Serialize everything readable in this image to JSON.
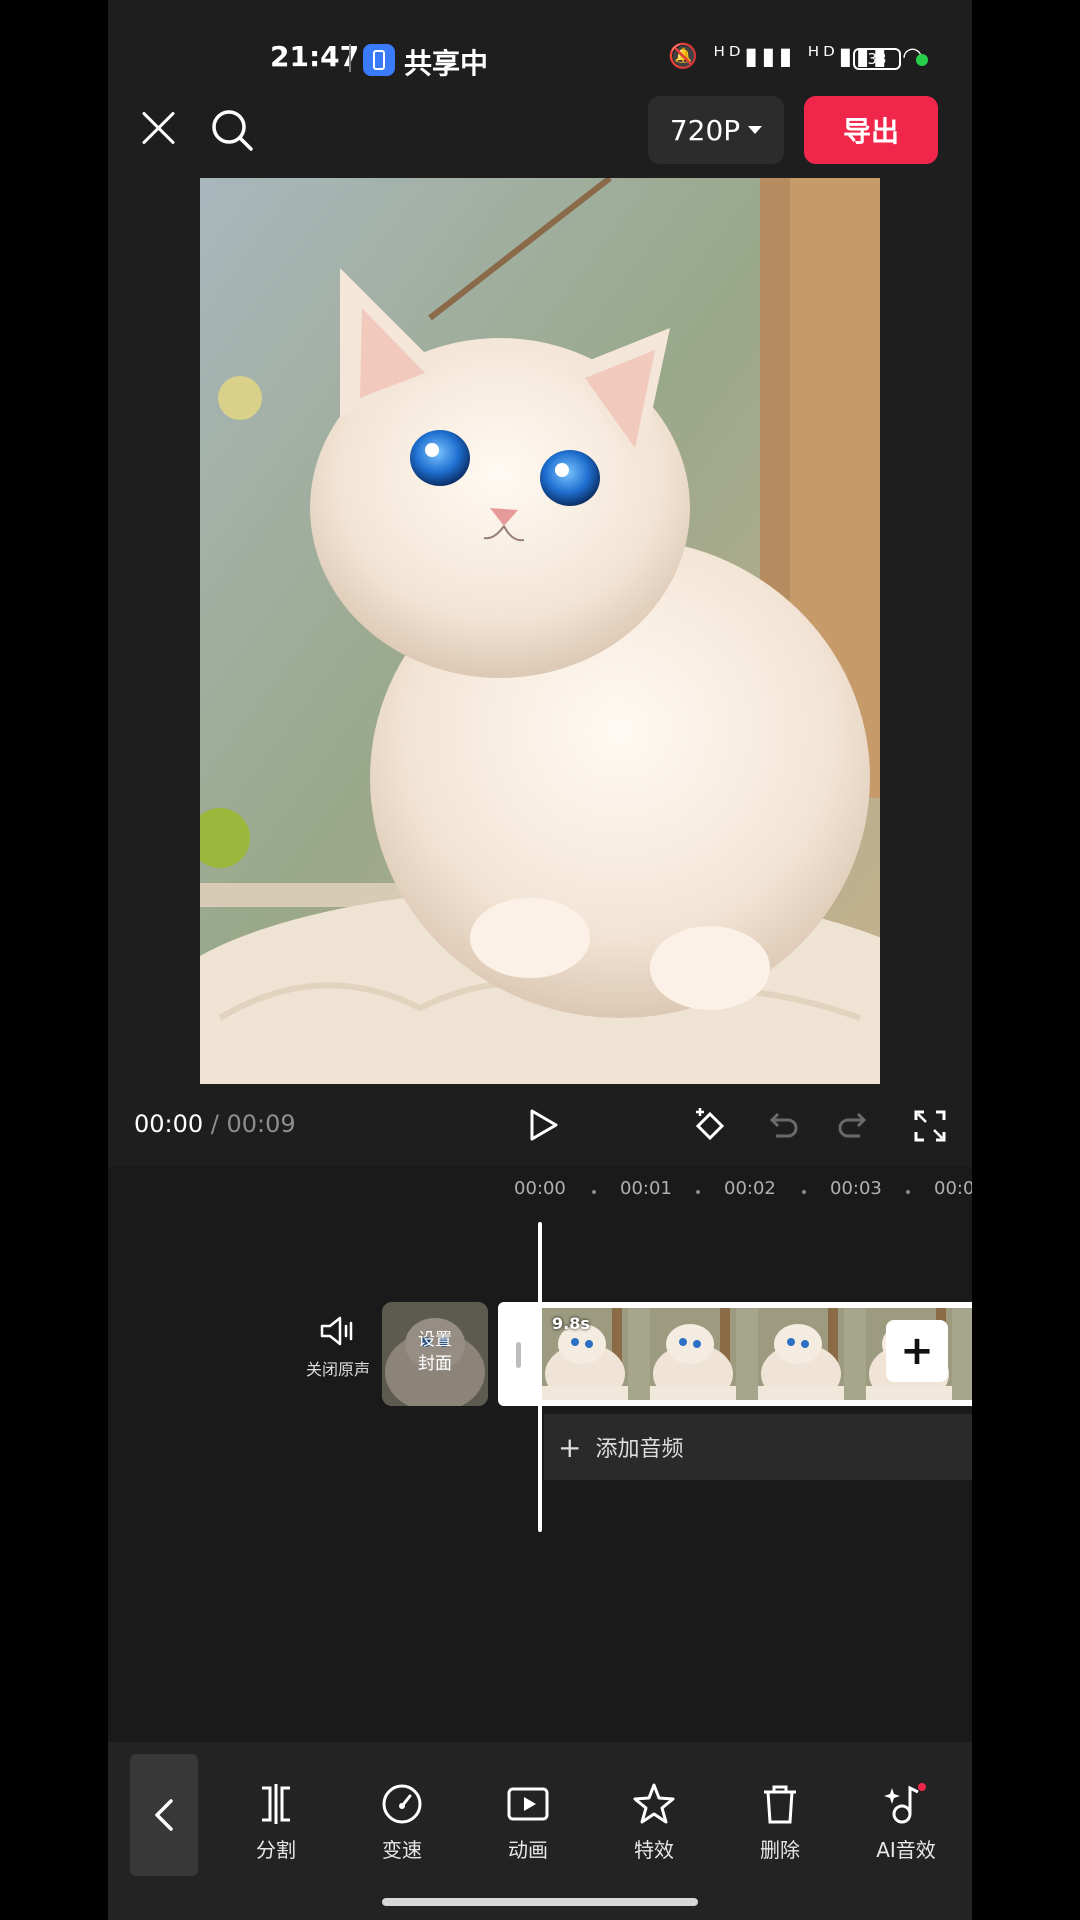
{
  "status_bar": {
    "time": "21:47",
    "share_label": "共享中",
    "network_icons": "🔕 ᴴᴰ▮▮▮ ᴴᴰ▮▮▮ ◠",
    "battery": "33"
  },
  "top_bar": {
    "resolution": "720P",
    "export_label": "导出"
  },
  "playback": {
    "current_time": "00:00",
    "separator": " / ",
    "total_time": "00:09"
  },
  "timeline": {
    "ruler": [
      "00:00",
      "00:01",
      "00:02",
      "00:03",
      "00:0"
    ],
    "mute_label": "关闭原声",
    "cover_label_1": "设置",
    "cover_label_2": "封面",
    "clip_duration": "9.8s",
    "add_clip": "+",
    "add_audio_label": "添加音频"
  },
  "toolbar": {
    "tools": [
      {
        "label": "分割",
        "icon": "split-icon"
      },
      {
        "label": "变速",
        "icon": "speed-icon"
      },
      {
        "label": "动画",
        "icon": "animation-icon"
      },
      {
        "label": "特效",
        "icon": "effects-icon"
      },
      {
        "label": "删除",
        "icon": "delete-icon"
      },
      {
        "label": "AI音效",
        "icon": "ai-sound-icon"
      }
    ]
  },
  "colors": {
    "accent": "#f0264b",
    "background": "#1e1e1e",
    "status_dot": "#26d04b"
  }
}
